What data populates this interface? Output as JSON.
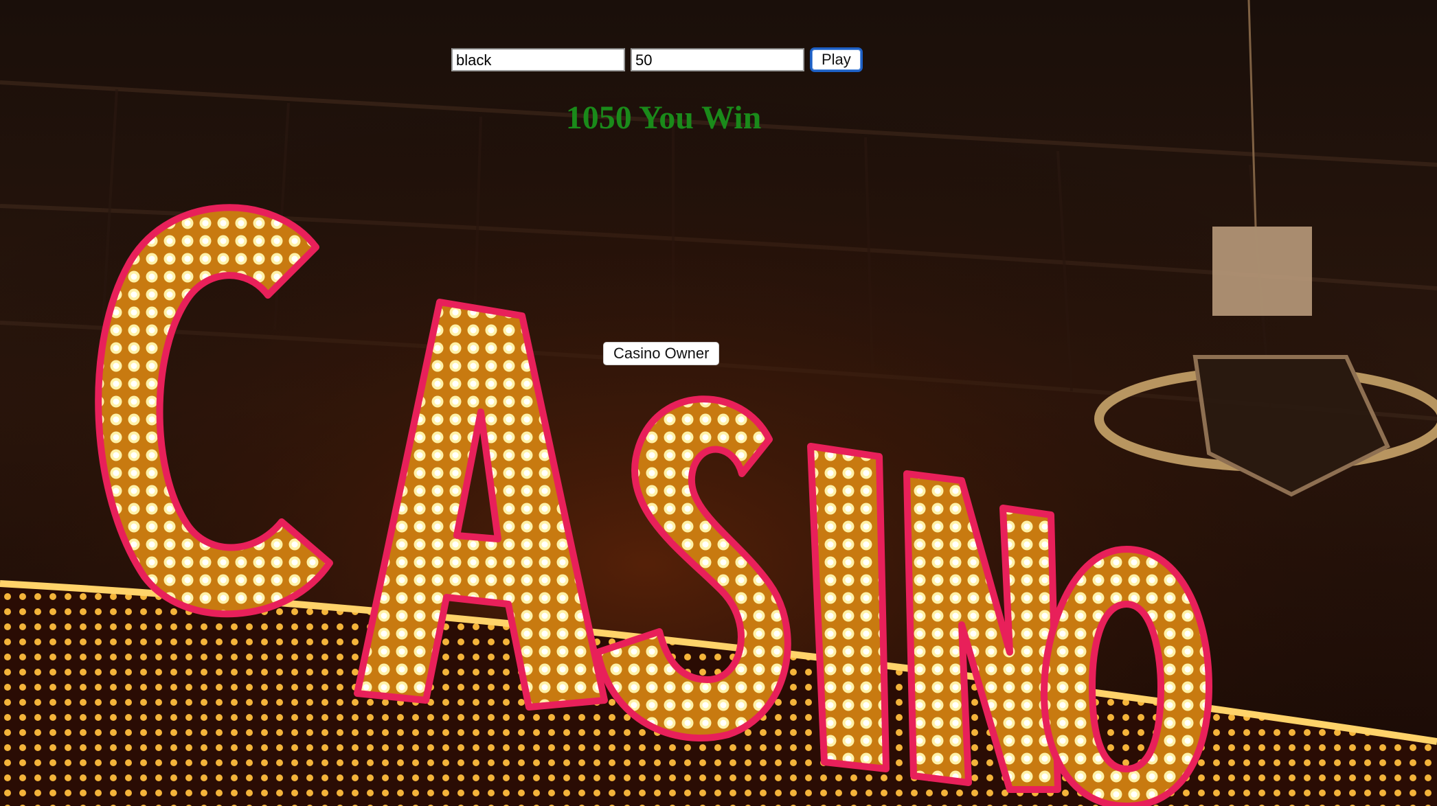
{
  "bet": {
    "color_value": "black",
    "amount_value": "50",
    "play_label": "Play"
  },
  "result_text": "1050 You Win",
  "owner_button_label": "Casino Owner",
  "background": {
    "sign_text": "CASINO",
    "colors": {
      "bulb": "#ffe27a",
      "neon": "#e8205a",
      "night": "#0d0604",
      "result": "#1a8a1a"
    }
  }
}
